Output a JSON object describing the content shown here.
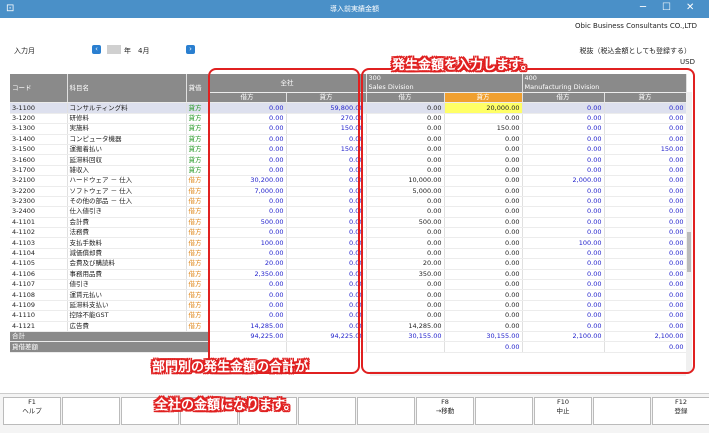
{
  "window": {
    "title": "導入前実績金額"
  },
  "header": {
    "company": "Obic Business Consultants CO.,LTD",
    "input_month_label": "入力月",
    "year_suffix": "年",
    "month": "4月",
    "tax_note": "税抜（税込金額としても登録する）",
    "currency": "USD",
    "prev_icon": "chevron-left-icon",
    "next_icon": "chevron-right-icon"
  },
  "columns": {
    "code": "コード",
    "account": "科目名",
    "side": "貸借",
    "all_company": "全社",
    "div1_code": "300",
    "div1_name": "Sales Division",
    "div2_code": "400",
    "div2_name": "Manufacturing Division",
    "debit": "借方",
    "credit": "貸方"
  },
  "rows": [
    {
      "code": "3-1100",
      "name": "コンサルティング料",
      "side": "貸方",
      "a_dr": "0.00",
      "a_cr": "59,800.00",
      "s_dr": "0.00",
      "s_cr": "20,000.00",
      "m_dr": "0.00",
      "m_cr": "0.00"
    },
    {
      "code": "3-1200",
      "name": "研修料",
      "side": "貸方",
      "a_dr": "0.00",
      "a_cr": "270.00",
      "s_dr": "0.00",
      "s_cr": "0.00",
      "m_dr": "0.00",
      "m_cr": "0.00"
    },
    {
      "code": "3-1300",
      "name": "実施料",
      "side": "貸方",
      "a_dr": "0.00",
      "a_cr": "150.00",
      "s_dr": "0.00",
      "s_cr": "150.00",
      "m_dr": "0.00",
      "m_cr": "0.00"
    },
    {
      "code": "3-1400",
      "name": "コンピュータ機器",
      "side": "貸方",
      "a_dr": "0.00",
      "a_cr": "0.00",
      "s_dr": "0.00",
      "s_cr": "0.00",
      "m_dr": "0.00",
      "m_cr": "0.00"
    },
    {
      "code": "3-1500",
      "name": "運搬着払い",
      "side": "貸方",
      "a_dr": "0.00",
      "a_cr": "150.00",
      "s_dr": "0.00",
      "s_cr": "0.00",
      "m_dr": "0.00",
      "m_cr": "150.00"
    },
    {
      "code": "3-1600",
      "name": "延滞料回収",
      "side": "貸方",
      "a_dr": "0.00",
      "a_cr": "0.00",
      "s_dr": "0.00",
      "s_cr": "0.00",
      "m_dr": "0.00",
      "m_cr": "0.00"
    },
    {
      "code": "3-1700",
      "name": "雑収入",
      "side": "貸方",
      "a_dr": "0.00",
      "a_cr": "0.00",
      "s_dr": "0.00",
      "s_cr": "0.00",
      "m_dr": "0.00",
      "m_cr": "0.00"
    },
    {
      "code": "3-2100",
      "name": "ハードウェア － 仕入",
      "side": "借方",
      "a_dr": "30,200.00",
      "a_cr": "0.00",
      "s_dr": "10,000.00",
      "s_cr": "0.00",
      "m_dr": "2,000.00",
      "m_cr": "0.00"
    },
    {
      "code": "3-2200",
      "name": "ソフトウェア － 仕入",
      "side": "借方",
      "a_dr": "7,000.00",
      "a_cr": "0.00",
      "s_dr": "5,000.00",
      "s_cr": "0.00",
      "m_dr": "0.00",
      "m_cr": "0.00"
    },
    {
      "code": "3-2300",
      "name": "その他の部品 － 仕入",
      "side": "借方",
      "a_dr": "0.00",
      "a_cr": "0.00",
      "s_dr": "0.00",
      "s_cr": "0.00",
      "m_dr": "0.00",
      "m_cr": "0.00"
    },
    {
      "code": "3-2400",
      "name": "仕入値引き",
      "side": "借方",
      "a_dr": "0.00",
      "a_cr": "0.00",
      "s_dr": "0.00",
      "s_cr": "0.00",
      "m_dr": "0.00",
      "m_cr": "0.00"
    },
    {
      "code": "4-1101",
      "name": "会計費",
      "side": "借方",
      "a_dr": "500.00",
      "a_cr": "0.00",
      "s_dr": "500.00",
      "s_cr": "0.00",
      "m_dr": "0.00",
      "m_cr": "0.00"
    },
    {
      "code": "4-1102",
      "name": "法務費",
      "side": "借方",
      "a_dr": "0.00",
      "a_cr": "0.00",
      "s_dr": "0.00",
      "s_cr": "0.00",
      "m_dr": "0.00",
      "m_cr": "0.00"
    },
    {
      "code": "4-1103",
      "name": "支払手数料",
      "side": "借方",
      "a_dr": "100.00",
      "a_cr": "0.00",
      "s_dr": "0.00",
      "s_cr": "0.00",
      "m_dr": "100.00",
      "m_cr": "0.00"
    },
    {
      "code": "4-1104",
      "name": "減価償却費",
      "side": "借方",
      "a_dr": "0.00",
      "a_cr": "0.00",
      "s_dr": "0.00",
      "s_cr": "0.00",
      "m_dr": "0.00",
      "m_cr": "0.00"
    },
    {
      "code": "4-1105",
      "name": "会費及び購読料",
      "side": "借方",
      "a_dr": "20.00",
      "a_cr": "0.00",
      "s_dr": "20.00",
      "s_cr": "0.00",
      "m_dr": "0.00",
      "m_cr": "0.00"
    },
    {
      "code": "4-1106",
      "name": "事務用品費",
      "side": "借方",
      "a_dr": "2,350.00",
      "a_cr": "0.00",
      "s_dr": "350.00",
      "s_cr": "0.00",
      "m_dr": "0.00",
      "m_cr": "0.00"
    },
    {
      "code": "4-1107",
      "name": "値引き",
      "side": "借方",
      "a_dr": "0.00",
      "a_cr": "0.00",
      "s_dr": "0.00",
      "s_cr": "0.00",
      "m_dr": "0.00",
      "m_cr": "0.00"
    },
    {
      "code": "4-1108",
      "name": "運賃元払い",
      "side": "借方",
      "a_dr": "0.00",
      "a_cr": "0.00",
      "s_dr": "0.00",
      "s_cr": "0.00",
      "m_dr": "0.00",
      "m_cr": "0.00"
    },
    {
      "code": "4-1109",
      "name": "延滞料支払い",
      "side": "借方",
      "a_dr": "0.00",
      "a_cr": "0.00",
      "s_dr": "0.00",
      "s_cr": "0.00",
      "m_dr": "0.00",
      "m_cr": "0.00"
    },
    {
      "code": "4-1110",
      "name": "控除不能GST",
      "side": "借方",
      "a_dr": "0.00",
      "a_cr": "0.00",
      "s_dr": "0.00",
      "s_cr": "0.00",
      "m_dr": "0.00",
      "m_cr": "0.00"
    },
    {
      "code": "4-1121",
      "name": "広告費",
      "side": "借方",
      "a_dr": "14,285.00",
      "a_cr": "0.00",
      "s_dr": "14,285.00",
      "s_cr": "0.00",
      "m_dr": "0.00",
      "m_cr": "0.00"
    }
  ],
  "totals": {
    "label": "合計",
    "a_dr": "94,225.00",
    "a_cr": "94,225.00",
    "s_dr": "30,155.00",
    "s_cr": "30,155.00",
    "m_dr": "2,100.00",
    "m_cr": "2,100.00"
  },
  "difference": {
    "label": "貸借差額",
    "s_cr": "0.00",
    "m_cr": "0.00"
  },
  "callouts": {
    "top": "発生金額を入力します。",
    "bottom_line1": "部門別の発生金額の合計が",
    "bottom_line2": "全社の金額になります。"
  },
  "fkeys": [
    {
      "key": "F1",
      "label": "ヘルプ"
    },
    {
      "key": "",
      "label": ""
    },
    {
      "key": "",
      "label": ""
    },
    {
      "key": "",
      "label": ""
    },
    {
      "key": "",
      "label": ""
    },
    {
      "key": "",
      "label": ""
    },
    {
      "key": "",
      "label": ""
    },
    {
      "key": "F8",
      "label": "→移動"
    },
    {
      "key": "",
      "label": ""
    },
    {
      "key": "F10",
      "label": "中止"
    },
    {
      "key": "",
      "label": ""
    },
    {
      "key": "F12",
      "label": "登録"
    }
  ],
  "colors": {
    "accent": "#4a90c8",
    "credit_side": "#2a9a2a",
    "debit_side": "#e08a20",
    "highlight": "#ffff66",
    "callout": "#e02020"
  }
}
